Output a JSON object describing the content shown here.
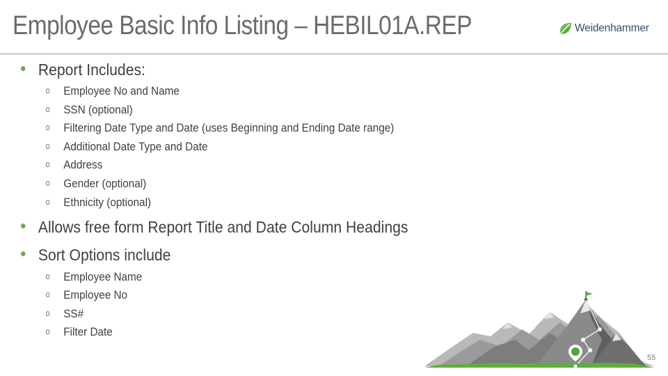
{
  "slide": {
    "title": "Employee Basic Info Listing – HEBIL01A.REP",
    "logo_text": "Weidenhammer",
    "page_number": "55",
    "colors": {
      "accent_green": "#76a35f",
      "title_gray": "#6b6b6b",
      "rule_green": "#7fa86a",
      "logo_navy": "#3b4e68"
    }
  },
  "sections": [
    {
      "heading": "Report Includes:",
      "items": [
        "Employee No and Name",
        "SSN (optional)",
        "Filtering Date Type and Date (uses Beginning and Ending Date range)",
        "Additional Date Type and Date",
        "Address",
        "Gender (optional)",
        "Ethnicity (optional)"
      ]
    },
    {
      "heading": "Allows free form Report Title and Date Column Headings",
      "items": []
    },
    {
      "heading": "Sort Options include",
      "items": [
        "Employee Name",
        "Employee No",
        "SS#",
        "Filter Date"
      ]
    }
  ],
  "icons": {
    "bullet_primary": "filled-circle",
    "bullet_secondary": "hollow-circle",
    "logo_mark": "green-leaf-icon",
    "illustration": "mountain-summit-flag-illustration"
  }
}
